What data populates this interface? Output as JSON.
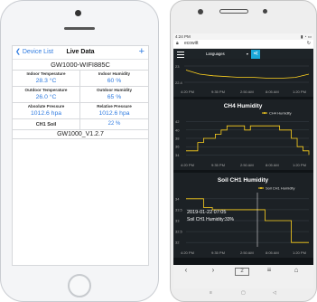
{
  "iphone_app": {
    "back_label": "Device List",
    "title": "Live Data",
    "add_label": "+",
    "device_name": "GW1000-WIFI885C",
    "readings": [
      {
        "label": "Indoor Temperature",
        "value": "28.3 °C"
      },
      {
        "label": "Indoor Humidity",
        "value": "60 %"
      },
      {
        "label": "Outdoor Temperature",
        "value": "26.0 °C"
      },
      {
        "label": "Outdoor Humidity",
        "value": "65 %"
      },
      {
        "label": "Absolute Pressure",
        "value": "1012.6 hpa"
      },
      {
        "label": "Relative Pressure",
        "value": "1012.6 hpa"
      },
      {
        "label": "CH1 Soil",
        "value": "22 %"
      }
    ],
    "firmware": "GW1000_V1.2.7"
  },
  "android_app": {
    "status_time": "4:24 PM",
    "url": "ecowitt",
    "language_select": "Languages",
    "colors": {
      "accent": "#ffd21f",
      "share": "#1ba8d9",
      "panel_bg": "#1c2125"
    },
    "nav_icons": [
      "back-icon",
      "forward-icon",
      "tabs-icon",
      "menu-icon",
      "home-icon"
    ],
    "chart_data": [
      {
        "type": "line",
        "title": "",
        "x_ticks": [
          "4:20 PM",
          "9:35 PM",
          "2:50 AM",
          "8:05 AM",
          "1:20 PM"
        ],
        "y_ticks": [
          "22.4",
          "23"
        ],
        "series": [
          {
            "name": "",
            "values": [
              22.45,
              22.4,
              22.38,
              22.37,
              22.36,
              22.36,
              22.35,
              22.35,
              22.36,
              22.4
            ]
          }
        ]
      },
      {
        "type": "line",
        "title": "CH4 Humidity",
        "x_ticks": [
          "4:20 PM",
          "9:35 PM",
          "2:50 AM",
          "8:05 AM",
          "1:20 PM"
        ],
        "y_ticks": [
          "34",
          "36",
          "38",
          "40",
          "42"
        ],
        "ylim": [
          33,
          43
        ],
        "legend": "top-right",
        "series": [
          {
            "name": "CH4 Humidity",
            "values": [
              35,
              35,
              37,
              38,
              38,
              39,
              40,
              41,
              41,
              41,
              40,
              41,
              41,
              41,
              41,
              41,
              40,
              40,
              38,
              36,
              35,
              34
            ]
          }
        ]
      },
      {
        "type": "line",
        "title": "Soil CH1 Humidity",
        "x_ticks": [
          "4:20 PM",
          "9:35 PM",
          "2:50 AM",
          "8:05 AM",
          "1:20 PM"
        ],
        "y_ticks": [
          "32",
          "32.5",
          "33",
          "33.5",
          "34"
        ],
        "ylim": [
          31.8,
          34.2
        ],
        "legend": "top-right",
        "tooltip": {
          "time": "2019-01-22 07:05",
          "text": "Soil CH1 Humidity:33%"
        },
        "series": [
          {
            "name": "Soil CH1 Humidity",
            "values": [
              34,
              34,
              33.6,
              33.5,
              33.5,
              33.5,
              33.5,
              33.5,
              33.5,
              33,
              33,
              33,
              32,
              32,
              32
            ]
          }
        ]
      }
    ]
  }
}
